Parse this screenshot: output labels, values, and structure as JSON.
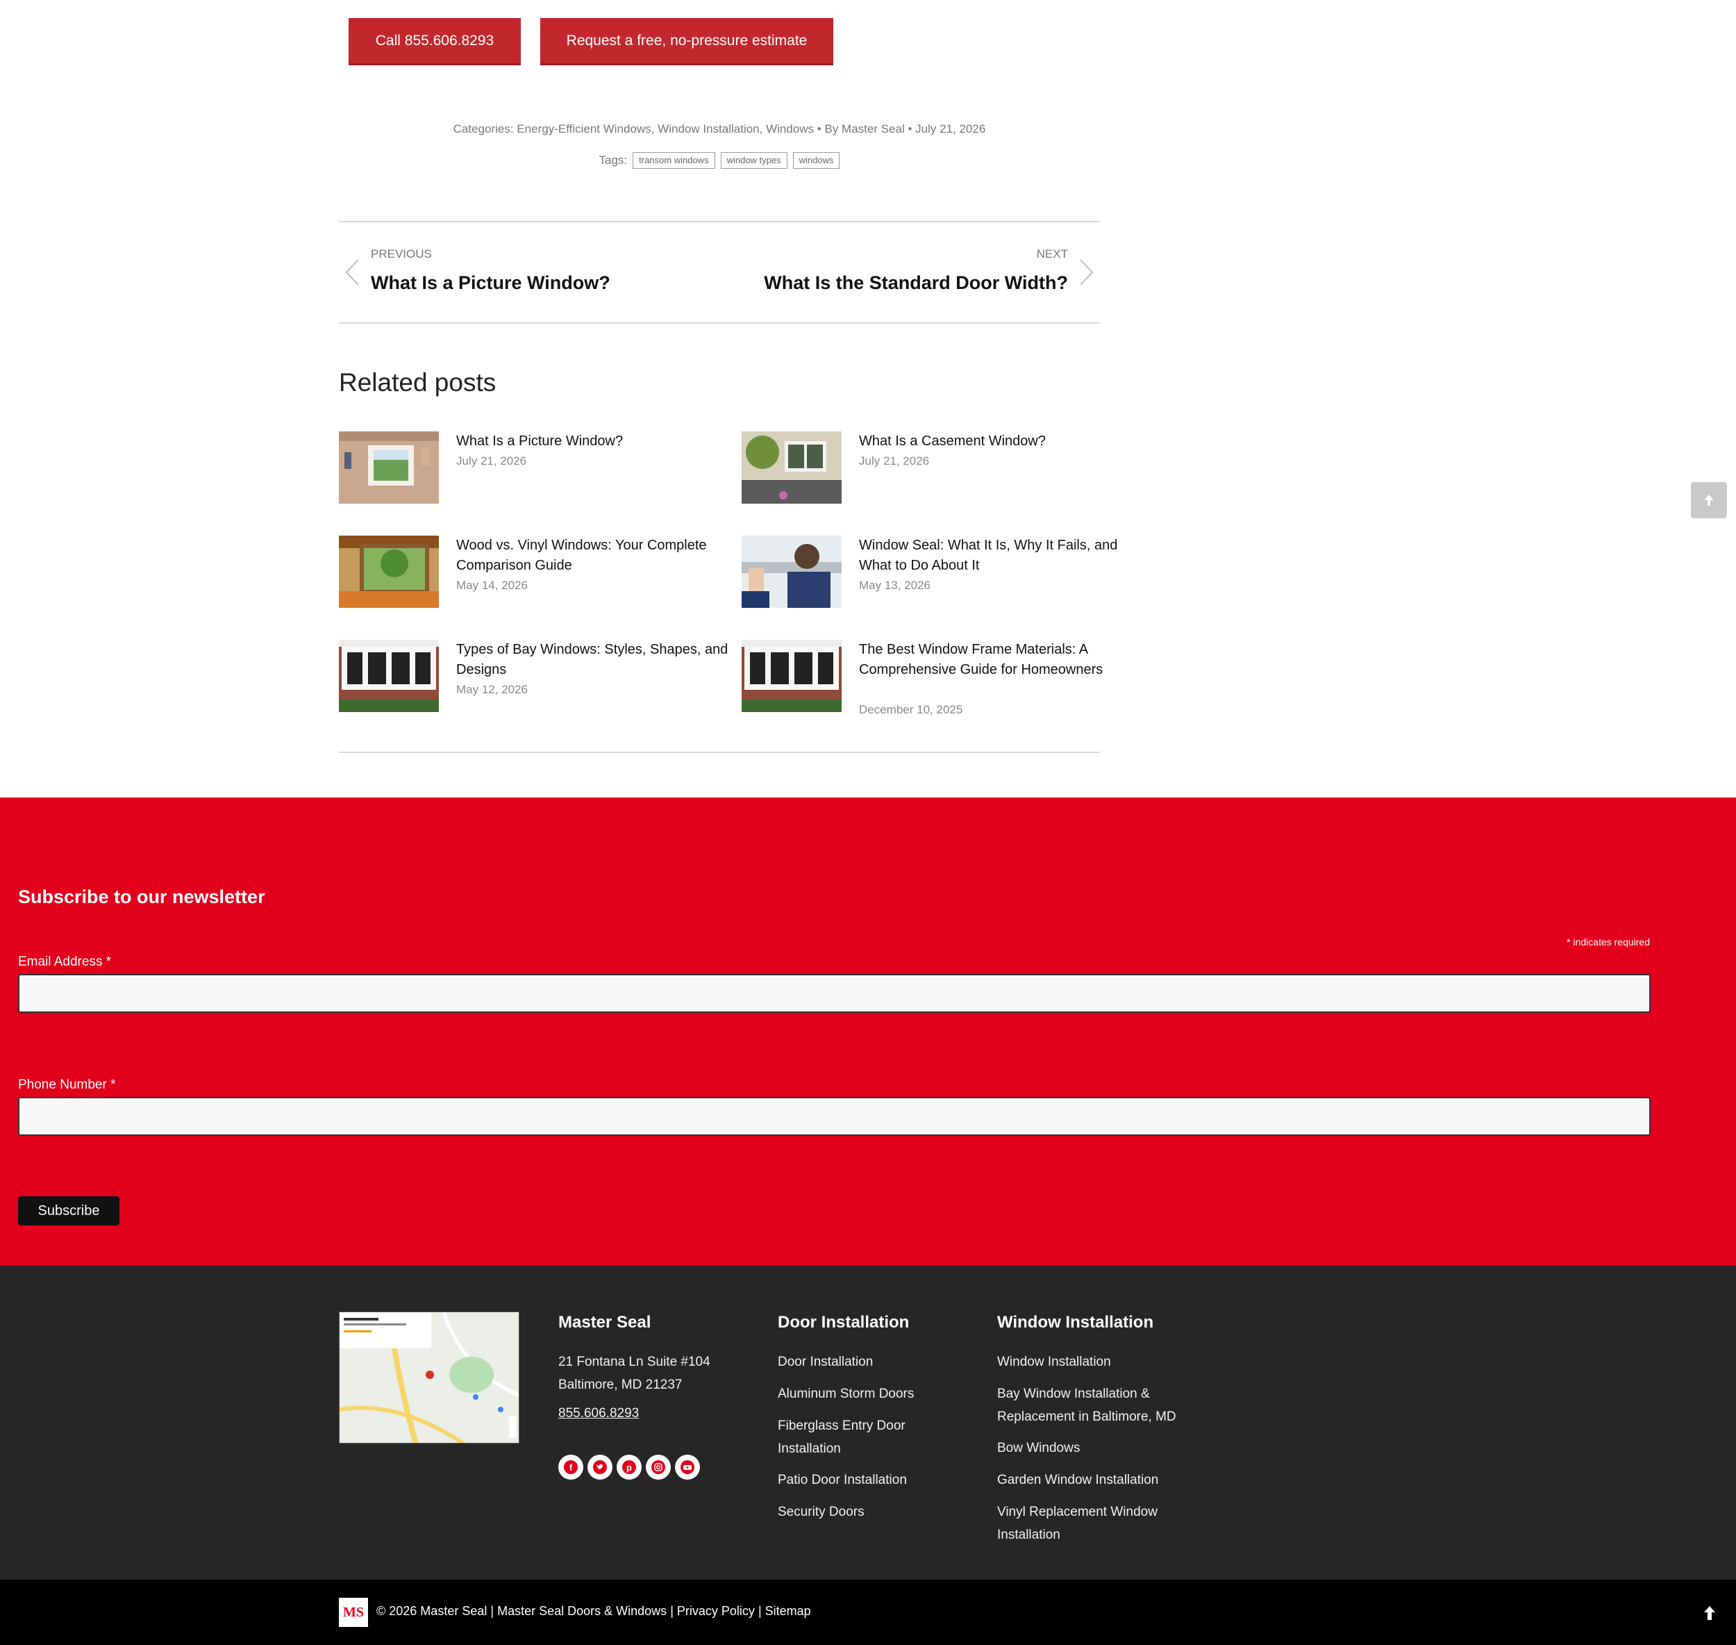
{
  "cta": {
    "call_label": "Call 855.606.8293",
    "estimate_label": "Request a free, no-pressure estimate"
  },
  "meta": {
    "categories_prefix": "Categories:",
    "categories": [
      "Energy-Efficient Windows",
      "Window Installation",
      "Windows"
    ],
    "author": "By Master Seal",
    "date": "July 21, 2026",
    "tags_label": "Tags:",
    "tags": [
      "transom windows",
      "window types",
      "windows"
    ]
  },
  "post_nav": {
    "prev_label": "PREVIOUS",
    "prev_title": "What Is a Picture Window?",
    "next_label": "NEXT",
    "next_title": "What Is the Standard Door Width?"
  },
  "related": {
    "heading": "Related posts",
    "posts": [
      {
        "title": "What Is a Picture Window?",
        "date": "July 21, 2026"
      },
      {
        "title": "What Is a Casement Window?",
        "date": "July 21, 2026"
      },
      {
        "title": "Wood vs. Vinyl Windows: Your Complete Comparison Guide",
        "date": "May 14, 2026"
      },
      {
        "title": "Window Seal: What It Is, Why It Fails, and What to Do About It",
        "date": "May 13, 2026"
      },
      {
        "title": "Types of Bay Windows: Styles, Shapes, and Designs",
        "date": "May 12, 2026"
      },
      {
        "title": "The Best Window Frame Materials: A Comprehensive Guide for Homeowners",
        "date": "December 10, 2025"
      }
    ]
  },
  "newsletter": {
    "title": "Subscribe to our newsletter",
    "required_note": "indicates required",
    "email_label": "Email Address",
    "phone_label": "Phone Number",
    "submit_label": "Subscribe"
  },
  "footer": {
    "company": {
      "heading": "Master Seal",
      "address_line1": "21 Fontana Ln Suite #104",
      "address_line2": "Baltimore, MD 21237",
      "phone": "855.606.8293"
    },
    "door": {
      "heading": "Door Installation",
      "links": [
        "Door Installation",
        "Aluminum Storm Doors",
        "Fiberglass Entry Door Installation",
        "Patio Door Installation",
        "Security Doors"
      ]
    },
    "window": {
      "heading": "Window Installation",
      "links": [
        "Window Installation",
        "Bay Window Installation & Replacement in Baltimore, MD",
        "Bow Windows",
        "Garden Window Installation",
        "Vinyl Replacement Window Installation"
      ]
    },
    "social_icons": [
      "facebook-icon",
      "twitter-icon",
      "pinterest-icon",
      "instagram-icon",
      "youtube-icon"
    ]
  },
  "bottom": {
    "logo_text": "MS",
    "copyright": "© 2026 Master Seal",
    "link1": "Master Seal Doors & Windows",
    "link2": "Privacy Policy",
    "link3": "Sitemap",
    "separator": "|"
  },
  "colors": {
    "brand_red": "#e2001c",
    "button_red": "#c1272d",
    "footer_dark": "#262626"
  }
}
